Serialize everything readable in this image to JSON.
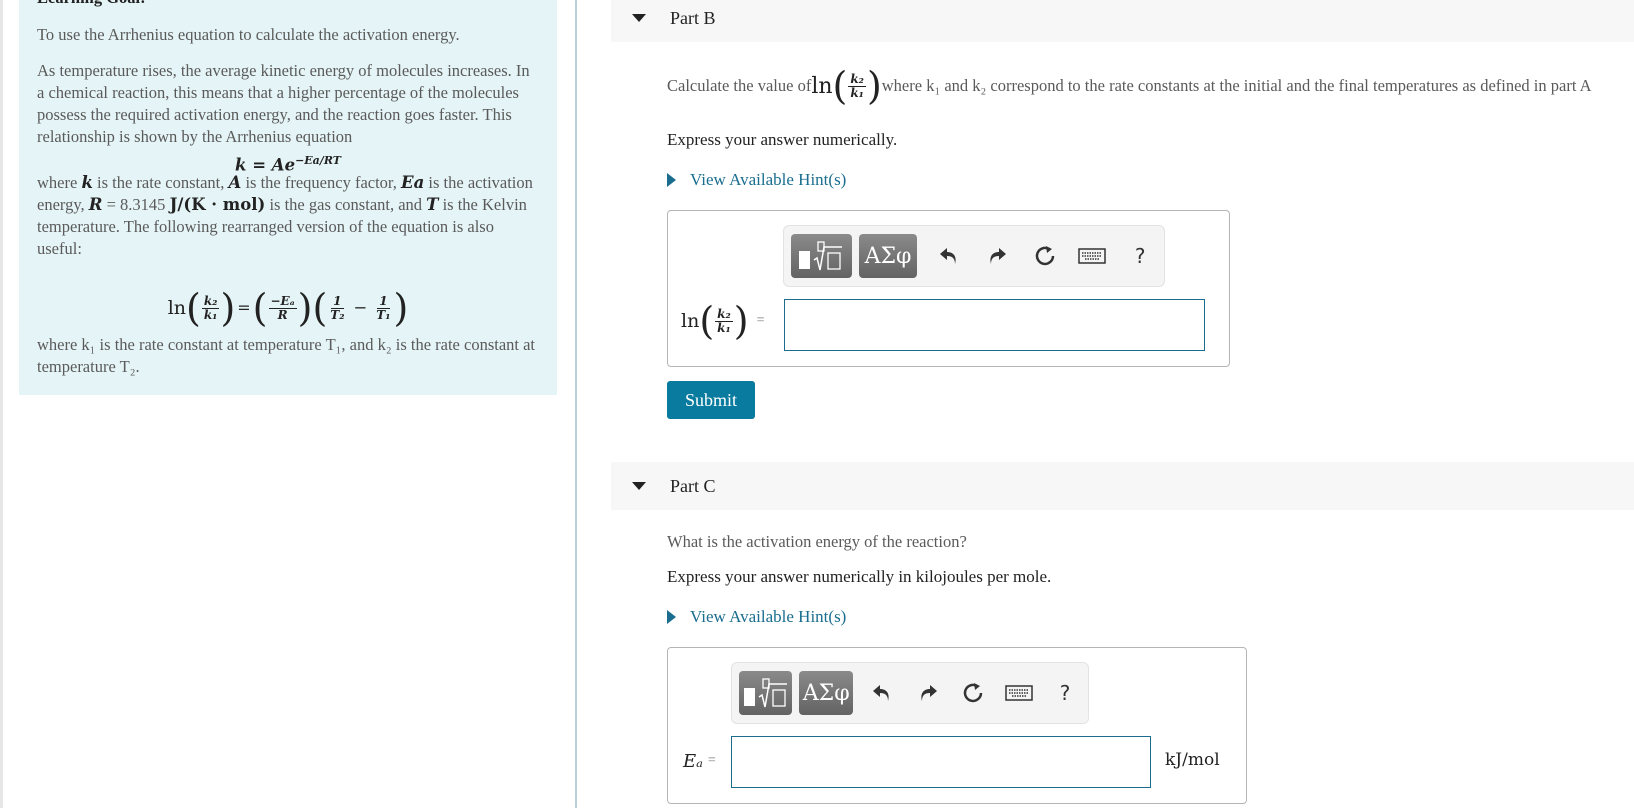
{
  "learning_goal": {
    "title": "Learning Goal:",
    "intro": "To use the Arrhenius equation to calculate the activation energy.",
    "para1": "As temperature rises, the average kinetic energy of molecules increases. In a chemical reaction, this means that a higher percentage of the molecules possess the required activation energy, and the reaction goes faster. This relationship is shown by the Arrhenius equation",
    "equation1": {
      "lhs": "k = Ae",
      "exponent": "−Ea/RT"
    },
    "para2_a": "where ",
    "para2_k": "k",
    "para2_b": " is the rate constant, ",
    "para2_A": "A",
    "para2_c": " is the frequency factor, ",
    "para2_Ea": "Ea",
    "para2_d": " is the activation energy, ",
    "para2_R": "R",
    "para2_e": " = 8.3145 ",
    "para2_unit": "J/(K · mol)",
    "para2_f": " is the gas constant, and ",
    "para2_T": "T",
    "para2_g": " is the Kelvin temperature. The following rearranged version of the equation is also useful:",
    "equation2": {
      "ln": "ln",
      "num1": "k₂",
      "den1": "k₁",
      "num2": "−Eₐ",
      "den2": "R",
      "num3": "1",
      "den3": "T₂",
      "minus": "−",
      "num4": "1",
      "den4": "T₁",
      "equals": "="
    },
    "para3": "where k₁ is the rate constant at temperature T₁, and k₂ is the rate constant at temperature T₂."
  },
  "part_b": {
    "title": "Part B",
    "question_pre": "Calculate the value of ",
    "question_ln": "ln",
    "question_num": "k₂",
    "question_den": "k₁",
    "question_post": " where k₁ and k₂ correspond to the rate constants at the initial and the final temperatures as defined in part A",
    "instruction": "Express your answer numerically.",
    "hint_label": "View Available Hint(s)",
    "answer_label_ln": "ln",
    "answer_label_num": "k₂",
    "answer_label_den": "k₁",
    "answer_eq": "=",
    "answer_value": "",
    "submit_label": "Submit"
  },
  "part_c": {
    "title": "Part C",
    "question": "What is the activation energy of the reaction?",
    "instruction": "Express your answer numerically in kilojoules per mole.",
    "hint_label": "View Available Hint(s)",
    "answer_label": "Eₐ",
    "answer_eq": "=",
    "answer_value": "",
    "units": "kJ/mol"
  },
  "toolbar": {
    "templates_icon": "templates-icon",
    "symbols_label": "ΑΣφ",
    "undo_icon": "undo-icon",
    "redo_icon": "redo-icon",
    "reset_icon": "reset-icon",
    "keyboard_icon": "keyboard-icon",
    "help_label": "?"
  }
}
